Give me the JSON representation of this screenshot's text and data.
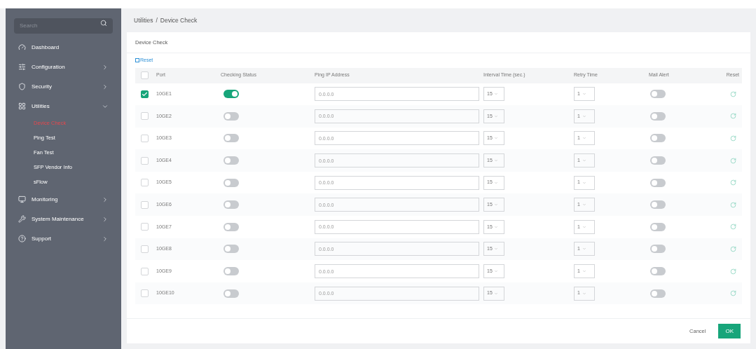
{
  "sidebar": {
    "search": {
      "placeholder": "Search"
    },
    "items": [
      {
        "label": "Dashboard"
      },
      {
        "label": "Configuration",
        "expanded": false
      },
      {
        "label": "Security",
        "expanded": false
      },
      {
        "label": "Utilities",
        "expanded": true,
        "children": [
          {
            "label": "Device Check",
            "selected": true
          },
          {
            "label": "Ping Test",
            "selected": false
          },
          {
            "label": "Fan Test",
            "selected": false
          },
          {
            "label": "SFP Vendor Info",
            "selected": false
          },
          {
            "label": "sFlow",
            "selected": false
          }
        ]
      },
      {
        "label": "Monitoring",
        "expanded": false
      },
      {
        "label": "System Maintenance",
        "expanded": false
      },
      {
        "label": "Support",
        "expanded": false
      }
    ]
  },
  "breadcrumb": [
    "Utilities",
    "/",
    "Device Check"
  ],
  "card_title": "Device Check",
  "reset_link": "Reset",
  "table": {
    "all_selected": false,
    "columns": [
      "Port",
      "Checking Status",
      "Ping IP Address",
      "Interval Time (sec.)",
      "Retry Time",
      "Mail Alert",
      "Reset"
    ],
    "rows": [
      {
        "selected": true,
        "port": "10GE1",
        "checking": true,
        "ip": "0.0.0.0",
        "interval": "15",
        "retry": "1",
        "mail_alert": false
      },
      {
        "selected": false,
        "port": "10GE2",
        "checking": false,
        "ip": "0.0.0.0",
        "interval": "15",
        "retry": "1",
        "mail_alert": false
      },
      {
        "selected": false,
        "port": "10GE3",
        "checking": false,
        "ip": "0.0.0.0",
        "interval": "15",
        "retry": "1",
        "mail_alert": false
      },
      {
        "selected": false,
        "port": "10GE4",
        "checking": false,
        "ip": "0.0.0.0",
        "interval": "15",
        "retry": "1",
        "mail_alert": false
      },
      {
        "selected": false,
        "port": "10GE5",
        "checking": false,
        "ip": "0.0.0.0",
        "interval": "15",
        "retry": "1",
        "mail_alert": false
      },
      {
        "selected": false,
        "port": "10GE6",
        "checking": false,
        "ip": "0.0.0.0",
        "interval": "15",
        "retry": "1",
        "mail_alert": false
      },
      {
        "selected": false,
        "port": "10GE7",
        "checking": false,
        "ip": "0.0.0.0",
        "interval": "15",
        "retry": "1",
        "mail_alert": false
      },
      {
        "selected": false,
        "port": "10GE8",
        "checking": false,
        "ip": "0.0.0.0",
        "interval": "15",
        "retry": "1",
        "mail_alert": false
      },
      {
        "selected": false,
        "port": "10GE9",
        "checking": false,
        "ip": "0.0.0.0",
        "interval": "15",
        "retry": "1",
        "mail_alert": false
      },
      {
        "selected": false,
        "port": "10GE10",
        "checking": false,
        "ip": "0.0.0.0",
        "interval": "15",
        "retry": "1",
        "mail_alert": false
      }
    ]
  },
  "buttons": [
    {
      "label": "Cancel",
      "kind": "secondary"
    },
    {
      "label": "OK",
      "kind": "primary"
    }
  ]
}
